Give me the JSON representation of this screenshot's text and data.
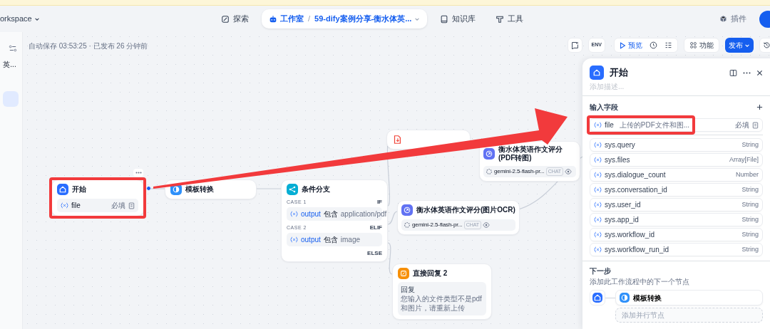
{
  "header": {
    "workspace": "orkspace",
    "nav": [
      {
        "kind": "explore",
        "label": "探索",
        "selected": false
      },
      {
        "kind": "studio",
        "label": "工作室",
        "separator": "/",
        "app": "59-dify案例分享-衡水体英...",
        "selected": true
      },
      {
        "kind": "knowledge",
        "label": "知识库",
        "selected": false
      },
      {
        "kind": "tools",
        "label": "工具",
        "selected": false
      }
    ],
    "plugins": "插件"
  },
  "sidebar": {
    "app_name": "英..."
  },
  "status": "自动保存 03:53:25 · 已发布 26 分钟前",
  "toolbar": {
    "env": "ENV",
    "preview": "预览",
    "features": "功能",
    "publish": "发布"
  },
  "nodes": [
    {
      "kind": "start",
      "title": "开始",
      "fields": [
        {
          "name": "file",
          "required": "必填"
        }
      ]
    },
    {
      "kind": "template",
      "title": "模板转换"
    },
    {
      "kind": "if_else",
      "title": "条件分支",
      "cases": [
        {
          "label": "CASE 1",
          "branch": "IF",
          "variable": "output",
          "operator": "包含",
          "value": "application/pdf"
        },
        {
          "label": "CASE 2",
          "branch": "ELIF",
          "variable": "output",
          "operator": "包含",
          "value": "image"
        }
      ],
      "else": "ELSE"
    },
    {
      "kind": "doc_extractor"
    },
    {
      "kind": "llm",
      "title": "衡水体英语作文评分(PDF转图)",
      "model": "gemini-2.5-flash-pr...",
      "mode": "CHAT"
    },
    {
      "kind": "llm",
      "title": "衡水体英语作文评分(图片OCR)",
      "model": "gemini-2.5-flash-pr...",
      "mode": "CHAT"
    },
    {
      "kind": "answer",
      "title": "直接回复 2",
      "label": "回复",
      "text": "您输入的文件类型不是pdf和图片，请重新上传"
    }
  ],
  "panel": {
    "title": "开始",
    "description": {
      "placeholder": "添加描述..."
    },
    "input_title": "输入字段",
    "inputs": [
      {
        "name": "file",
        "description": "上传的PDF文件和图...",
        "required": "必填"
      }
    ],
    "system_vars": [
      {
        "name": "sys.query",
        "type": "String"
      },
      {
        "name": "sys.files",
        "type": "Array[File]"
      },
      {
        "name": "sys.dialogue_count",
        "type": "Number"
      },
      {
        "name": "sys.conversation_id",
        "type": "String"
      },
      {
        "name": "sys.user_id",
        "type": "String"
      },
      {
        "name": "sys.app_id",
        "type": "String"
      },
      {
        "name": "sys.workflow_id",
        "type": "String"
      },
      {
        "name": "sys.workflow_run_id",
        "type": "String"
      }
    ],
    "next": {
      "title": "下一步",
      "hint": "添加此工作流程中的下一个节点",
      "node": "模板转换",
      "add_parallel": "添加并行节点"
    }
  }
}
